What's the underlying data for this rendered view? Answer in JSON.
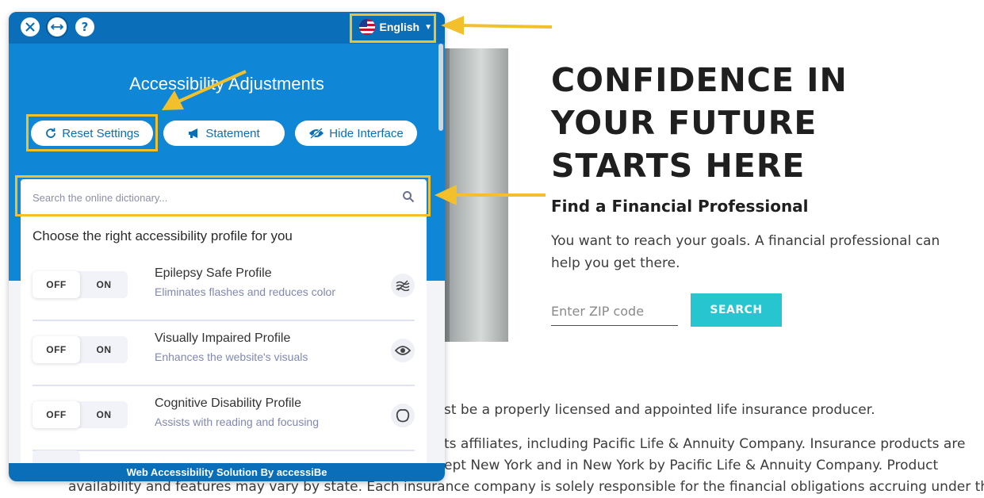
{
  "page": {
    "hero_title": "CONFIDENCE IN YOUR FUTURE STARTS HERE",
    "find_title": "Find a Financial Professional",
    "find_desc": "You want to reach your goals. A financial professional can help you get there.",
    "zip_placeholder": "Enter ZIP code",
    "search_label": "SEARCH",
    "disclaimer": [
      "st be a properly licensed and appointed life insurance producer.",
      "ts affiliates, including Pacific Life & Annuity Company. Insurance products are",
      "ept New York and in New York by Pacific Life & Annuity Company. Product",
      "availability and features may vary by state. Each insurance company is solely responsible for the financial obligations accruing under the"
    ]
  },
  "panel": {
    "toolbar": {
      "close_icon": "close-icon",
      "resize_icon": "resize-icon",
      "help_label": "?",
      "language_label": "English",
      "language_flag": "us-flag-icon"
    },
    "title": "Accessibility Adjustments",
    "actions": {
      "reset_label": "Reset Settings",
      "statement_label": "Statement",
      "hide_label": "Hide Interface"
    },
    "dictionary_placeholder": "Search the online dictionary...",
    "profiles_heading": "Choose the right accessibility profile for you",
    "toggle": {
      "off": "OFF",
      "on": "ON"
    },
    "profiles": [
      {
        "name": "Epilepsy Safe Profile",
        "desc": "Eliminates flashes and reduces color",
        "icon": "waves-icon"
      },
      {
        "name": "Visually Impaired Profile",
        "desc": "Enhances the website's visuals",
        "icon": "eye-icon"
      },
      {
        "name": "Cognitive Disability Profile",
        "desc": "Assists with reading and focusing",
        "icon": "brain-icon"
      }
    ],
    "footer": "Web Accessibility Solution By accessiBe"
  },
  "colors": {
    "panel_blue": "#0f86d6",
    "panel_dark_blue": "#0a6fb8",
    "search_teal": "#27c5cf",
    "highlight_yellow": "#f2c02b"
  }
}
